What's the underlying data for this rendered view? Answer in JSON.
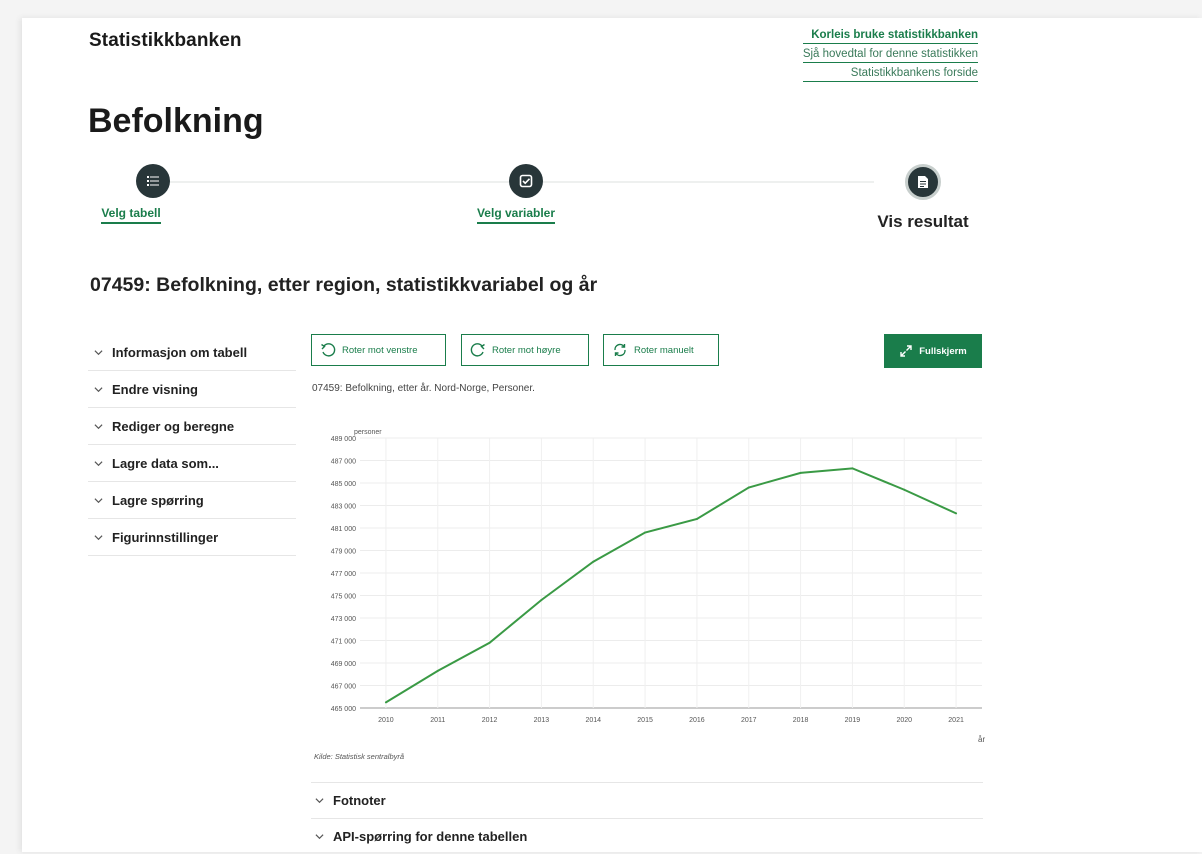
{
  "header": {
    "brand": "Statistikkbanken",
    "links": [
      "Korleis bruke statistikkbanken",
      "Sjå hovedtal for denne statistikken",
      "Statistikkbankens forside"
    ]
  },
  "page_title": "Befolkning",
  "steps": [
    {
      "label": "Velg tabell",
      "icon": "list-icon"
    },
    {
      "label": "Velg variabler",
      "icon": "checkbox-icon"
    },
    {
      "label": "Vis resultat",
      "icon": "document-icon"
    }
  ],
  "table_title": "07459: Befolkning, etter region, statistikkvariabel og år",
  "sidebar": {
    "items": [
      "Informasjon om tabell",
      "Endre visning",
      "Rediger og beregne",
      "Lagre data som...",
      "Lagre spørring",
      "Figurinnstillinger"
    ]
  },
  "toolbar": {
    "rotate_left": "Roter mot venstre",
    "rotate_right": "Roter mot høyre",
    "rotate_manual": "Roter manuelt",
    "fullscreen": "Fullskjerm"
  },
  "chart_caption": "07459: Befolkning, etter år. Nord-Norge, Personer.",
  "chart_source": "Kilde: Statistisk sentralbyrå",
  "accordions": [
    "Fotnoter",
    "API-spørring for denne tabellen"
  ],
  "colors": {
    "accent": "#1a7d4b",
    "step_circle": "#283639",
    "line": "#3a9a45"
  },
  "chart_data": {
    "type": "line",
    "x": [
      "2010",
      "2011",
      "2012",
      "2013",
      "2014",
      "2015",
      "2016",
      "2017",
      "2018",
      "2019",
      "2020",
      "2021"
    ],
    "series": [
      {
        "values": [
          465500,
          468300,
          470800,
          474600,
          478000,
          480600,
          481800,
          484600,
          485900,
          486300,
          484400,
          482300
        ]
      }
    ],
    "ylabel": "personer",
    "xlabel": "år",
    "ylim": [
      465000,
      489000
    ],
    "yticks": [
      "465 000",
      "467 000",
      "469 000",
      "471 000",
      "473 000",
      "475 000",
      "477 000",
      "479 000",
      "481 000",
      "483 000",
      "485 000",
      "487 000",
      "489 000"
    ],
    "grid": true
  }
}
